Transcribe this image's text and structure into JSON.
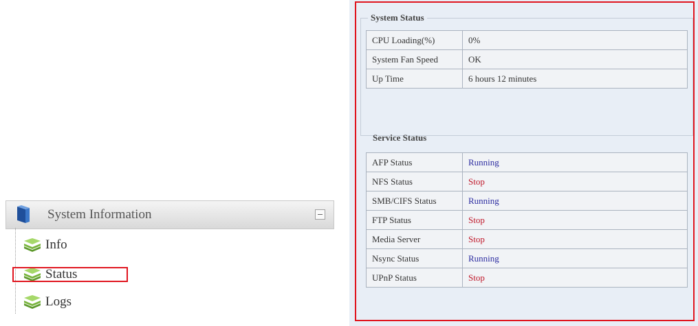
{
  "nav": {
    "title": "System Information",
    "items": [
      {
        "label": "Info"
      },
      {
        "label": "Status"
      },
      {
        "label": "Logs"
      }
    ]
  },
  "system_status": {
    "title": "System Status",
    "rows": [
      {
        "label": "CPU Loading(%)",
        "value": "0%"
      },
      {
        "label": "System Fan Speed",
        "value": "OK"
      },
      {
        "label": "Up Time",
        "value": "6 hours 12 minutes"
      }
    ]
  },
  "service_status": {
    "title": "Service Status",
    "rows": [
      {
        "label": "AFP Status",
        "value": "Running",
        "state": "running"
      },
      {
        "label": "NFS Status",
        "value": "Stop",
        "state": "stop"
      },
      {
        "label": "SMB/CIFS Status",
        "value": "Running",
        "state": "running"
      },
      {
        "label": "FTP Status",
        "value": "Stop",
        "state": "stop"
      },
      {
        "label": "Media Server",
        "value": "Stop",
        "state": "stop"
      },
      {
        "label": "Nsync Status",
        "value": "Running",
        "state": "running"
      },
      {
        "label": "UPnP Status",
        "value": "Stop",
        "state": "stop"
      }
    ]
  },
  "colors": {
    "running": "#2b2ba0",
    "stop": "#c0182a",
    "highlight": "#e0141e",
    "icon": "leaf-stack-icon"
  }
}
